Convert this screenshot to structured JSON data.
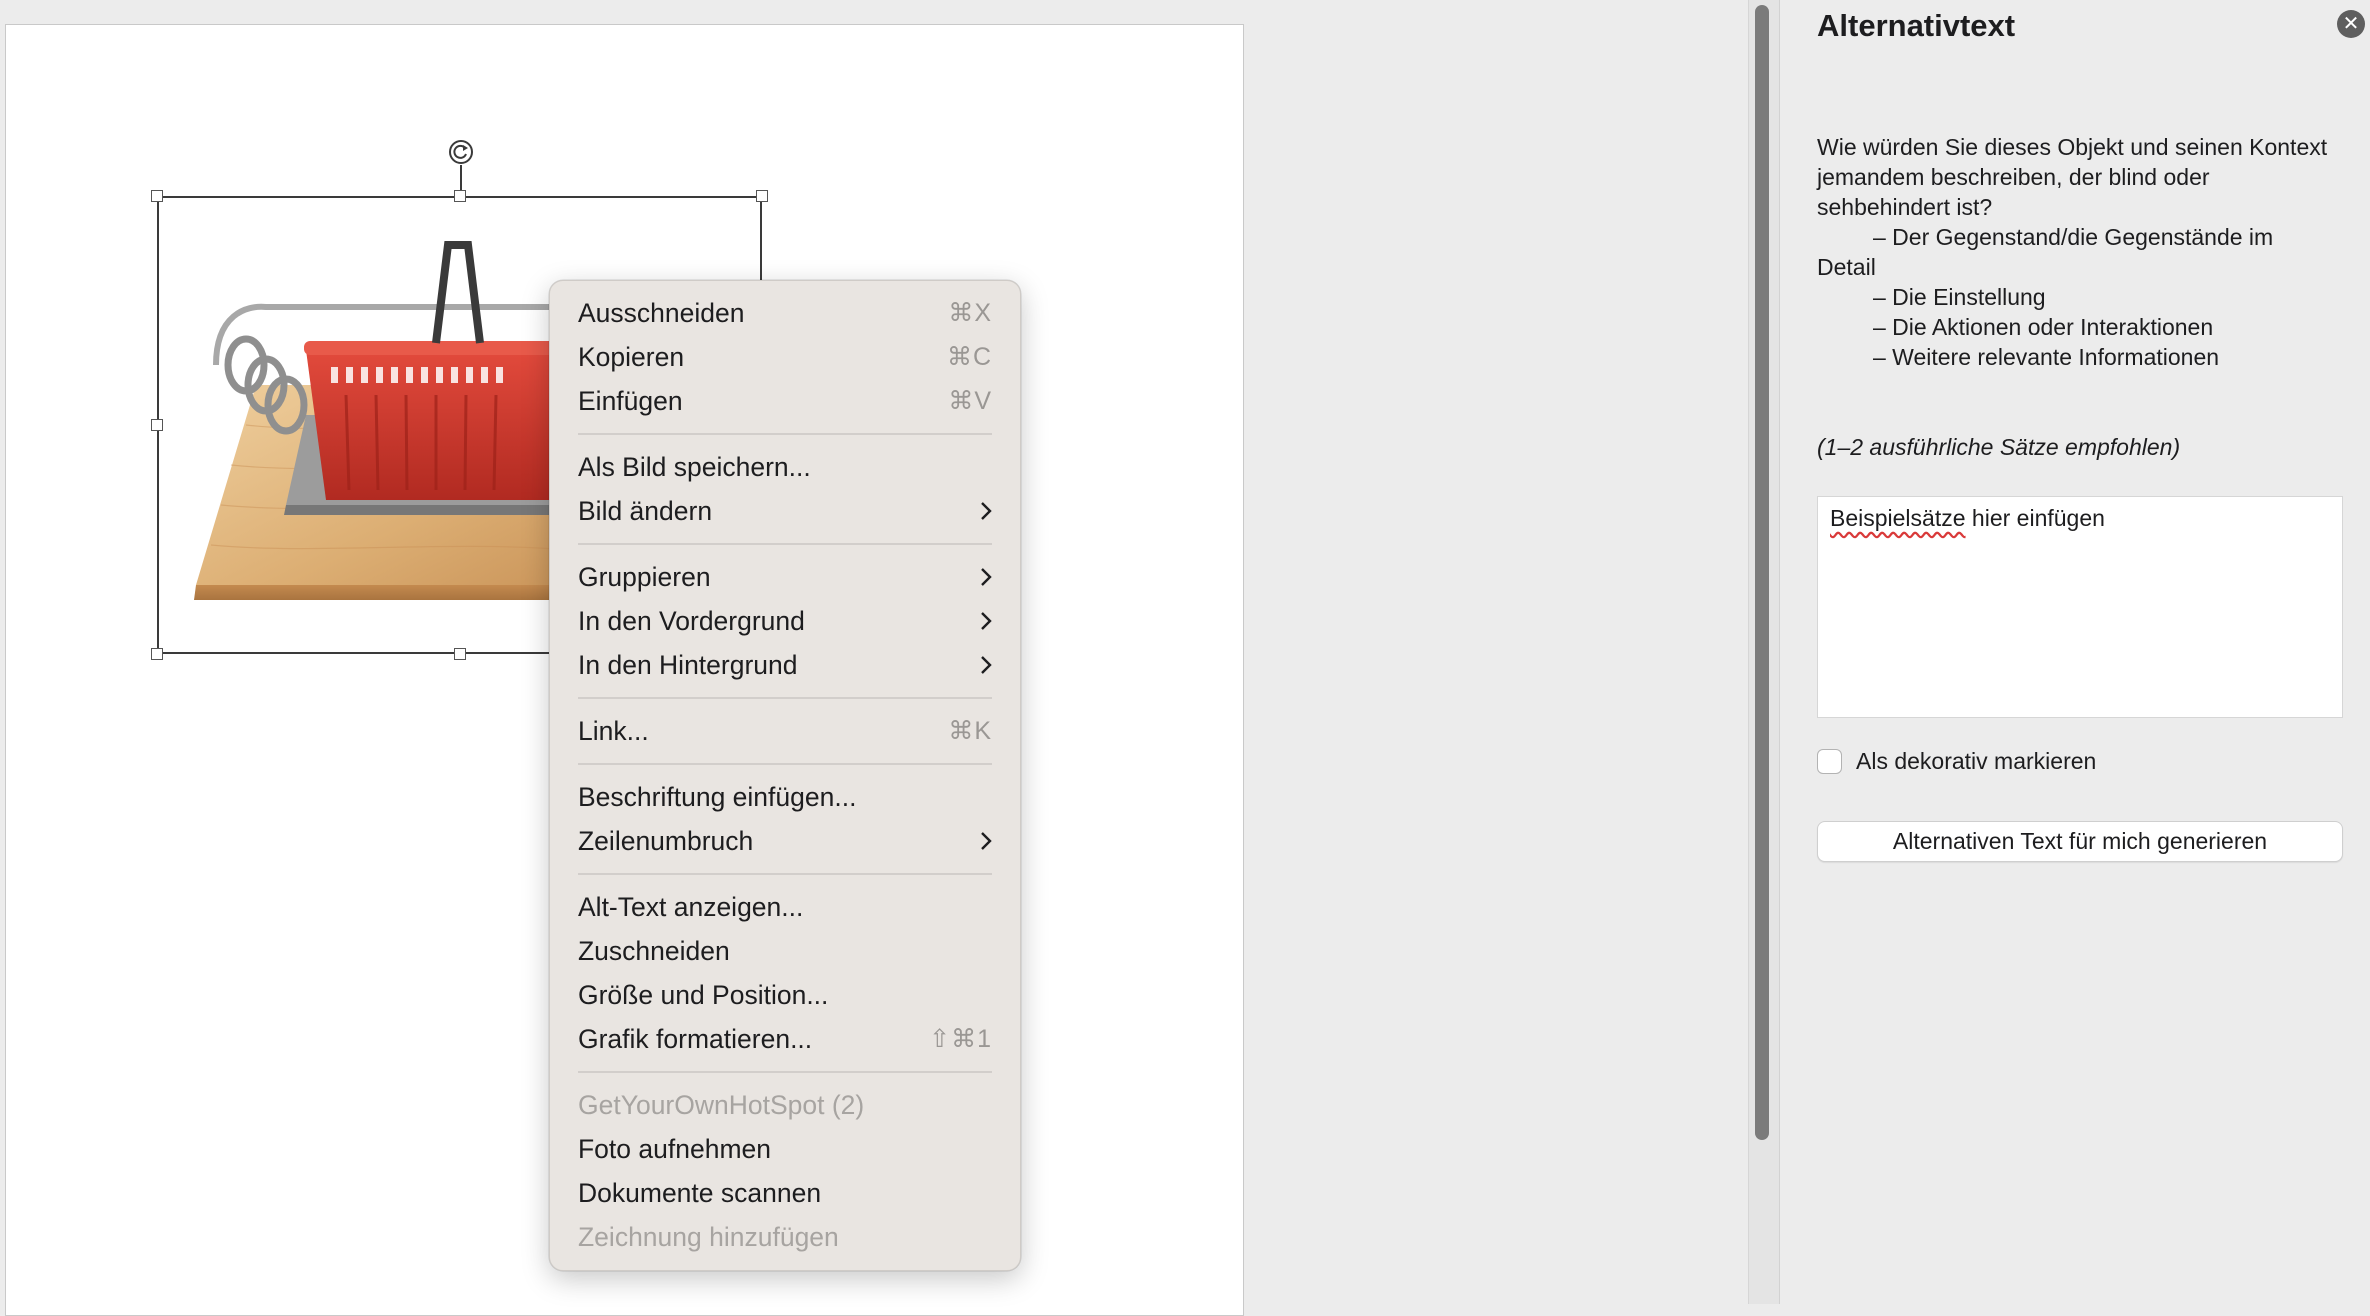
{
  "context_menu": {
    "groups": [
      [
        {
          "label": "Ausschneiden",
          "shortcut": "⌘X"
        },
        {
          "label": "Kopieren",
          "shortcut": "⌘C"
        },
        {
          "label": "Einfügen",
          "shortcut": "⌘V"
        }
      ],
      [
        {
          "label": "Als Bild speichern..."
        },
        {
          "label": "Bild ändern",
          "submenu": true
        }
      ],
      [
        {
          "label": "Gruppieren",
          "submenu": true
        },
        {
          "label": "In den Vordergrund",
          "submenu": true
        },
        {
          "label": "In den Hintergrund",
          "submenu": true
        }
      ],
      [
        {
          "label": "Link...",
          "shortcut": "⌘K"
        }
      ],
      [
        {
          "label": "Beschriftung einfügen..."
        },
        {
          "label": "Zeilenumbruch",
          "submenu": true
        }
      ],
      [
        {
          "label": "Alt-Text anzeigen..."
        },
        {
          "label": "Zuschneiden"
        },
        {
          "label": "Größe und Position..."
        },
        {
          "label": "Grafik formatieren...",
          "shortcut": "⇧⌘1"
        }
      ],
      [
        {
          "label": "GetYourOwnHotSpot (2)",
          "disabled": true
        },
        {
          "label": "Foto aufnehmen"
        },
        {
          "label": "Dokumente scannen"
        },
        {
          "label": "Zeichnung hinzufügen",
          "disabled": true
        }
      ]
    ]
  },
  "alt_text_pane": {
    "title": "Alternativtext",
    "close_icon": "close-icon",
    "question": "Wie würden Sie dieses Objekt und seinen Kontext jemandem beschreiben, der blind oder sehbehindert ist?",
    "bullets": [
      "– Der Gegenstand/die Gegenstände im",
      "Detail",
      "– Die Einstellung",
      "– Die Aktionen oder Interaktionen",
      "– Weitere relevante Informationen"
    ],
    "recommendation": "(1–2 ausführliche Sätze empfohlen)",
    "textarea_value_misspelled": "Beispielsätze",
    "textarea_value_rest": " hier einfügen",
    "decorative_label": "Als dekorativ markieren",
    "decorative_checked": false,
    "generate_button": "Alternativen Text für mich generieren"
  },
  "colors": {
    "basket_red": "#d23a2e",
    "board_wood": "#e2b77f",
    "menu_bg": "#e9e5e1"
  }
}
